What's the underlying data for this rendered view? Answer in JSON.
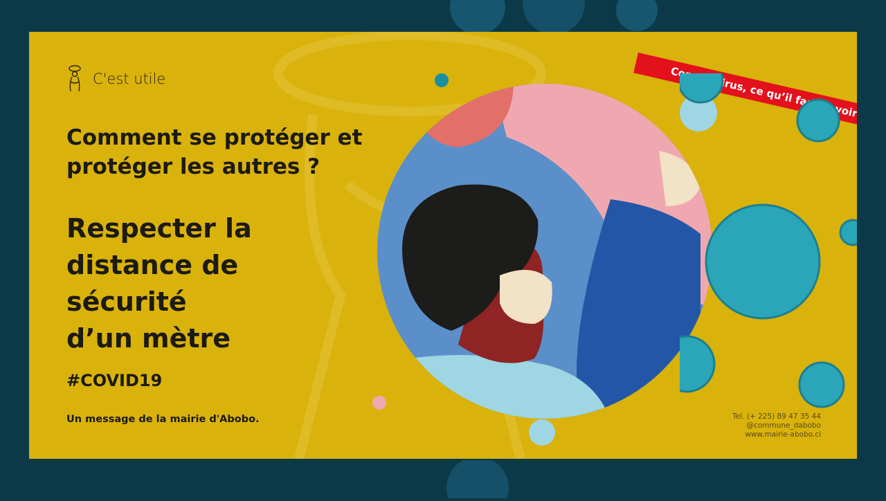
{
  "banner": {
    "text": "Corona virus, ce qu’il faut savoir",
    "color": "#e3111b"
  },
  "brand": {
    "label": "C'est utile",
    "icon": "woman-carrying-basket-icon"
  },
  "content": {
    "question": "Comment se protéger et protéger les autres ?",
    "headline_lines": [
      "Respecter la",
      "distance de",
      "sécurité",
      "d’un mètre"
    ],
    "hashtag": "#COVID19",
    "message": "Un message de la mairie d'Abobo."
  },
  "contact": {
    "phone": "Tel. (+ 225) 89 47 35 44",
    "social": "@commune_dabobo",
    "website": "www.mairie-abobo.ci"
  },
  "colors": {
    "background": "#0b3947",
    "poster": "#d9b20c",
    "virus": "#2aa6b8",
    "text": "#1b1a14"
  }
}
